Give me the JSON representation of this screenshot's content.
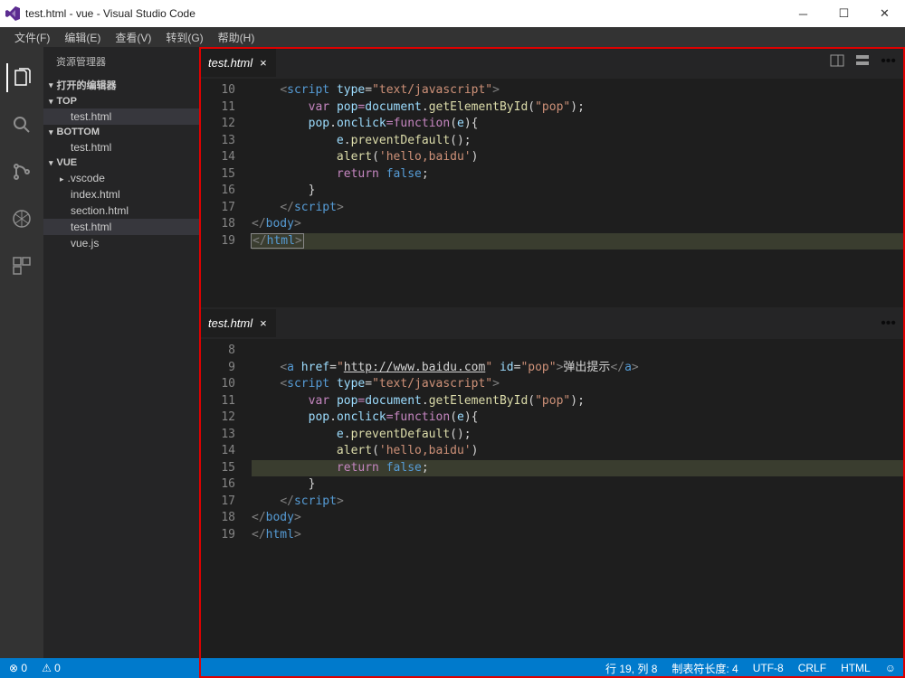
{
  "window": {
    "title": "test.html - vue - Visual Studio Code"
  },
  "menu": {
    "file": "文件(F)",
    "edit": "编辑(E)",
    "view": "查看(V)",
    "goto": "转到(G)",
    "help": "帮助(H)"
  },
  "sidebar": {
    "title": "资源管理器",
    "openEditors": {
      "label": "打开的编辑器"
    },
    "top": {
      "label": "TOP",
      "items": [
        "test.html"
      ]
    },
    "bottom": {
      "label": "BOTTOM",
      "items": [
        "test.html"
      ]
    },
    "vue": {
      "label": "VUE",
      "folder": ".vscode",
      "items": [
        "index.html",
        "section.html",
        "test.html",
        "vue.js"
      ]
    }
  },
  "tabs": {
    "top": "test.html",
    "bottom": "test.html"
  },
  "codeTop": {
    "start": 10,
    "lines": [
      {
        "i": "    ",
        "t": [
          [
            "<",
            "k-tag"
          ],
          [
            "script",
            "k-name"
          ],
          [
            " ",
            "k-txt"
          ],
          [
            "type",
            "k-attr"
          ],
          [
            "=",
            "k-op"
          ],
          [
            "\"text/javascript\"",
            "k-str"
          ],
          [
            ">",
            "k-tag"
          ]
        ]
      },
      {
        "i": "        ",
        "t": [
          [
            "var",
            "k-key"
          ],
          [
            " ",
            "k-txt"
          ],
          [
            "pop",
            "k-var"
          ],
          [
            "=",
            "k-eq"
          ],
          [
            "document",
            "k-var"
          ],
          [
            ".",
            "k-op"
          ],
          [
            "getElementById",
            "k-func"
          ],
          [
            "(",
            "k-op"
          ],
          [
            "\"pop\"",
            "k-str"
          ],
          [
            ");",
            "k-op"
          ]
        ]
      },
      {
        "i": "        ",
        "t": [
          [
            "pop",
            "k-var"
          ],
          [
            ".",
            "k-op"
          ],
          [
            "onclick",
            "k-var"
          ],
          [
            "=",
            "k-eq"
          ],
          [
            "function",
            "k-key"
          ],
          [
            "(",
            "k-op"
          ],
          [
            "e",
            "k-var"
          ],
          [
            "){",
            "k-op"
          ]
        ]
      },
      {
        "i": "            ",
        "t": [
          [
            "e",
            "k-var"
          ],
          [
            ".",
            "k-op"
          ],
          [
            "preventDefault",
            "k-func"
          ],
          [
            "();",
            "k-op"
          ]
        ]
      },
      {
        "i": "            ",
        "t": [
          [
            "alert",
            "k-func"
          ],
          [
            "(",
            "k-op"
          ],
          [
            "'hello,baidu'",
            "k-str"
          ],
          [
            ")",
            "k-op"
          ]
        ]
      },
      {
        "i": "            ",
        "t": [
          [
            "return",
            "k-key"
          ],
          [
            " ",
            "k-txt"
          ],
          [
            "false",
            "k-name"
          ],
          [
            ";",
            "k-op"
          ]
        ]
      },
      {
        "i": "        ",
        "t": [
          [
            "}",
            "k-op"
          ]
        ]
      },
      {
        "i": "    ",
        "t": [
          [
            "</",
            "k-tag"
          ],
          [
            "script",
            "k-name"
          ],
          [
            ">",
            "k-tag"
          ]
        ]
      },
      {
        "i": "",
        "t": [
          [
            "</",
            "k-tag"
          ],
          [
            "body",
            "k-name"
          ],
          [
            ">",
            "k-tag"
          ]
        ]
      },
      {
        "i": "",
        "hl": true,
        "cursor": true,
        "t": [
          [
            "</",
            "k-tag"
          ],
          [
            "html",
            "k-name"
          ],
          [
            ">",
            "k-tag"
          ]
        ]
      }
    ]
  },
  "codeBottom": {
    "start": 8,
    "lines": [
      {
        "i": "",
        "t": []
      },
      {
        "i": "    ",
        "t": [
          [
            "<",
            "k-tag"
          ],
          [
            "a",
            "k-name"
          ],
          [
            " ",
            "k-txt"
          ],
          [
            "href",
            "k-attr"
          ],
          [
            "=",
            "k-op"
          ],
          [
            "\"",
            "k-str"
          ],
          [
            "http://www.baidu.com",
            "k-link"
          ],
          [
            "\"",
            "k-str"
          ],
          [
            " ",
            "k-txt"
          ],
          [
            "id",
            "k-attr"
          ],
          [
            "=",
            "k-op"
          ],
          [
            "\"pop\"",
            "k-str"
          ],
          [
            ">",
            "k-tag"
          ],
          [
            "弹出提示",
            "k-txt"
          ],
          [
            "</",
            "k-tag"
          ],
          [
            "a",
            "k-name"
          ],
          [
            ">",
            "k-tag"
          ]
        ]
      },
      {
        "i": "    ",
        "t": [
          [
            "<",
            "k-tag"
          ],
          [
            "script",
            "k-name"
          ],
          [
            " ",
            "k-txt"
          ],
          [
            "type",
            "k-attr"
          ],
          [
            "=",
            "k-op"
          ],
          [
            "\"text/javascript\"",
            "k-str"
          ],
          [
            ">",
            "k-tag"
          ]
        ]
      },
      {
        "i": "        ",
        "t": [
          [
            "var",
            "k-key"
          ],
          [
            " ",
            "k-txt"
          ],
          [
            "pop",
            "k-var"
          ],
          [
            "=",
            "k-eq"
          ],
          [
            "document",
            "k-var"
          ],
          [
            ".",
            "k-op"
          ],
          [
            "getElementById",
            "k-func"
          ],
          [
            "(",
            "k-op"
          ],
          [
            "\"pop\"",
            "k-str"
          ],
          [
            ");",
            "k-op"
          ]
        ]
      },
      {
        "i": "        ",
        "t": [
          [
            "pop",
            "k-var"
          ],
          [
            ".",
            "k-op"
          ],
          [
            "onclick",
            "k-var"
          ],
          [
            "=",
            "k-eq"
          ],
          [
            "function",
            "k-key"
          ],
          [
            "(",
            "k-op"
          ],
          [
            "e",
            "k-var"
          ],
          [
            "){",
            "k-op"
          ]
        ]
      },
      {
        "i": "            ",
        "t": [
          [
            "e",
            "k-var"
          ],
          [
            ".",
            "k-op"
          ],
          [
            "preventDefault",
            "k-func"
          ],
          [
            "();",
            "k-op"
          ]
        ]
      },
      {
        "i": "            ",
        "t": [
          [
            "alert",
            "k-func"
          ],
          [
            "(",
            "k-op"
          ],
          [
            "'hello,baidu'",
            "k-str"
          ],
          [
            ")",
            "k-op"
          ]
        ]
      },
      {
        "i": "            ",
        "hl": true,
        "t": [
          [
            "return",
            "k-key"
          ],
          [
            " ",
            "k-txt"
          ],
          [
            "false",
            "k-name"
          ],
          [
            ";",
            "k-op"
          ]
        ]
      },
      {
        "i": "        ",
        "t": [
          [
            "}",
            "k-op"
          ]
        ]
      },
      {
        "i": "    ",
        "t": [
          [
            "</",
            "k-tag"
          ],
          [
            "script",
            "k-name"
          ],
          [
            ">",
            "k-tag"
          ]
        ]
      },
      {
        "i": "",
        "t": [
          [
            "</",
            "k-tag"
          ],
          [
            "body",
            "k-name"
          ],
          [
            ">",
            "k-tag"
          ]
        ]
      },
      {
        "i": "",
        "t": [
          [
            "</",
            "k-tag"
          ],
          [
            "html",
            "k-name"
          ],
          [
            ">",
            "k-tag"
          ]
        ]
      }
    ]
  },
  "status": {
    "errors": "0",
    "warnings": "0",
    "pos": "行 19, 列 8",
    "tab": "制表符长度: 4",
    "enc": "UTF-8",
    "eol": "CRLF",
    "lang": "HTML"
  }
}
